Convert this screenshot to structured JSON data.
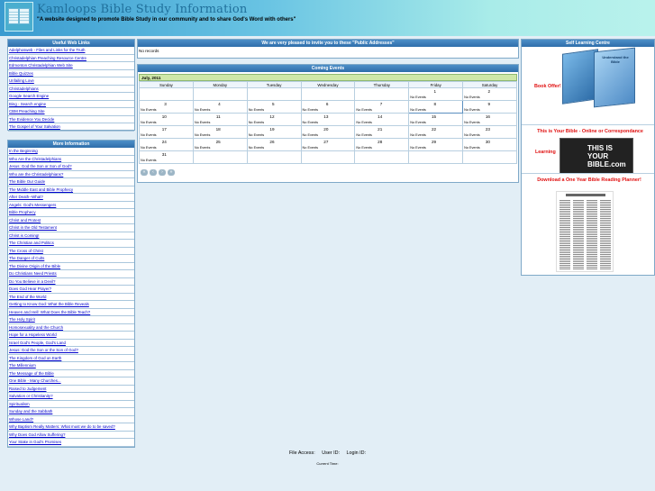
{
  "header": {
    "title": "Kamloops Bible Study Information",
    "tagline": "\"A website designed to promote Bible Study in our community and to share God's Word with others\""
  },
  "useful_links": {
    "title": "Useful Web Links",
    "items": [
      "Adelphosweb - Files and Links for the Truth",
      "Christadelphian Preaching Resource Centre",
      "Edmonton Christadelphian Web Site",
      "Bible Quizzes",
      "Unfailing Love",
      "Christadelphians",
      "Google Search Engine",
      "Bing - Search engine",
      "CBM Preaching Site",
      "The Evidence You Decide",
      "The Gospel of Your Salvation"
    ]
  },
  "more_info": {
    "title": "More Information",
    "items": [
      "In the Beginning",
      "Who Are the Christadelphians",
      "Jesus: God the Son or Son of God?",
      "Who are the Christadelphians?",
      "The Bible Our Guide",
      "The Middle East and Bible Prophecy",
      "After Death--What?",
      "Angels: God's Messengers",
      "Bible Prophecy",
      "Christ and Protest",
      "Christ in the Old Testament",
      "Christ is Coming!",
      "The Christian and Politics",
      "The Cross of Christ",
      "The Danger of Cults",
      "The Divine Origin of the Bible",
      "Do Christians Need Priests",
      "Do You Believe in a Devil?",
      "Does God Hear Prayer?",
      "The End of the World",
      "Getting to Know God: What the Bible Reveals",
      "Heaven and Hell: What Does the Bible Teach?",
      "The Holy Spirit",
      "Homosexuality and the Church",
      "Hope for a Hopeless World",
      "Israel God's People, God's Land",
      "Jesus: God the Son or the Son of God?",
      "The Kingdom of God on Earth",
      "The Millennium",
      "The Message of the Bible",
      "One Bible - Many Churches...",
      "Raised to Judgement",
      "Salvation or Christianity?",
      "Spiritualism",
      "Sunday and the Sabbath",
      "Whose Land?",
      "Why Baptism Really Matters: What must we do to be saved?",
      "Why Does God Allow Suffering?",
      "Your Stake in God's Promises"
    ]
  },
  "addresses": {
    "title": "We are very pleased to invite you to these \"Public Addresses\"",
    "body": "No records"
  },
  "events": {
    "title": "Coming Events",
    "month": "July, 2011",
    "weekdays": [
      "Sunday",
      "Monday",
      "Tuesday",
      "Wednesday",
      "Thursday",
      "Friday",
      "Saturday"
    ],
    "no_events": "No Events",
    "weeks": [
      [
        "",
        "",
        "",
        "",
        "",
        "1",
        "2"
      ],
      [
        "3",
        "4",
        "5",
        "6",
        "7",
        "8",
        "9"
      ],
      [
        "10",
        "11",
        "12",
        "13",
        "14",
        "15",
        "16"
      ],
      [
        "17",
        "18",
        "19",
        "20",
        "21",
        "22",
        "23"
      ],
      [
        "24",
        "25",
        "26",
        "27",
        "28",
        "29",
        "30"
      ],
      [
        "31",
        "",
        "",
        "",
        "",
        "",
        ""
      ]
    ],
    "today": "8",
    "nav_icons": [
      "previous-year-icon",
      "previous-month-icon",
      "next-month-icon",
      "next-year-icon"
    ]
  },
  "learning": {
    "title": "Self Learning Centre",
    "book_offer": "Book Offer!",
    "book_cover_title": "Understand the Bible",
    "bible_course_title": "This is Your Bible - Online or Correspondance",
    "bible_course_learning": "Learning",
    "bible_image_text": "THIS IS YOUR BIBLE.com",
    "planner_title": "Download a One Year Bible Reading Planner!"
  },
  "footer": {
    "file_access": "File Access:",
    "user_id": "User ID:",
    "login_id": "Login ID:",
    "current_time": "Current Time:"
  },
  "colors": {
    "panel_header": "#2e6eaa",
    "link": "#0000cc",
    "red_text": "#e01010",
    "month_bar": "#cfe8a8",
    "background": "#e2eef6"
  }
}
